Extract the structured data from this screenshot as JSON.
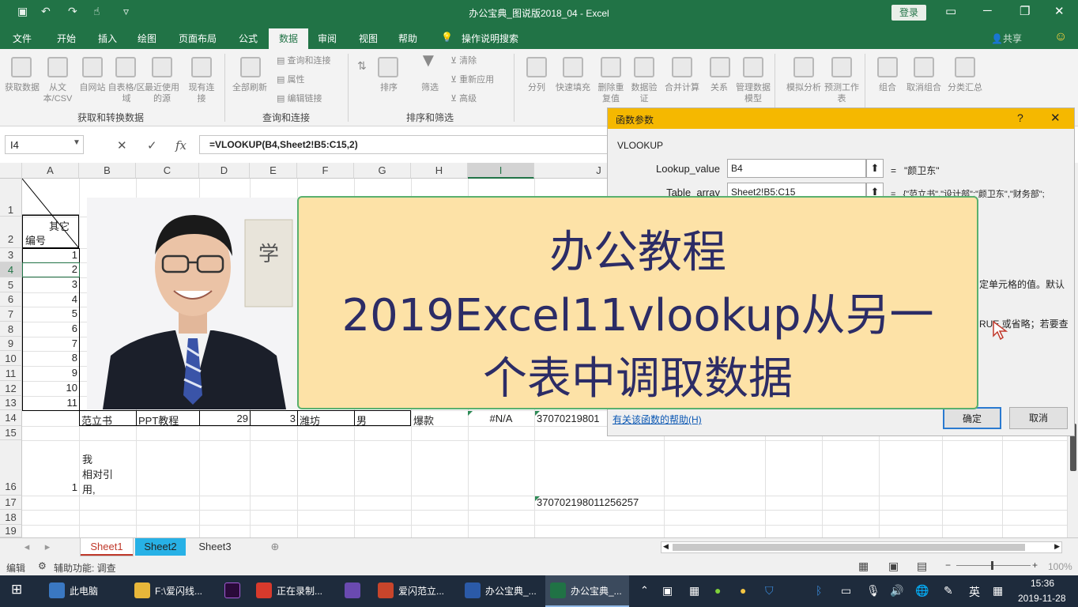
{
  "window": {
    "title": "办公宝典_图说版2018_04 - Excel",
    "login_label": "登录"
  },
  "tabs": [
    "文件",
    "开始",
    "插入",
    "绘图",
    "页面布局",
    "公式",
    "数据",
    "审阅",
    "视图",
    "帮助",
    "操作说明搜索"
  ],
  "active_tab": "数据",
  "share_label": "共享",
  "ribbon": {
    "groups": [
      "获取和转换数据",
      "查询和连接",
      "排序和筛选"
    ],
    "buttons": {
      "get_data": "获取数据",
      "from_csv": "从文本/CSV",
      "from_web": "自网站",
      "from_table": "自表格/区域",
      "recent": "最近使用的源",
      "existing": "现有连接",
      "refresh_all": "全部刷新",
      "queries": "查询和连接",
      "properties": "属性",
      "edit_links": "编辑链接",
      "sort": "排序",
      "filter": "筛选",
      "clear": "清除",
      "reapply": "重新应用",
      "advanced": "高级",
      "split": "分列",
      "flash_fill": "快速填充",
      "remove_dup": "删除重复值",
      "validation": "数据验证",
      "consolidate": "合并计算",
      "relations": "关系",
      "data_model": "管理数据模型",
      "what_if": "模拟分析",
      "forecast": "预测工作表",
      "group": "组合",
      "ungroup": "取消组合",
      "subtotal": "分类汇总"
    }
  },
  "formula_bar": {
    "name_box": "I4",
    "formula": "=VLOOKUP(B4,Sheet2!B5:C15,2)"
  },
  "sheet": {
    "columns": [
      "A",
      "B",
      "C",
      "D",
      "E",
      "F",
      "G",
      "H",
      "I",
      "J"
    ],
    "rows": [
      "1",
      "2",
      "3",
      "4",
      "5",
      "6",
      "7",
      "8",
      "9",
      "10",
      "11",
      "12",
      "13",
      "14",
      "15",
      "16",
      "17",
      "18",
      "19"
    ],
    "header_cell": {
      "top": "其它",
      "bottom": "编号"
    },
    "col_a_numbers": [
      "1",
      "2",
      "3",
      "4",
      "5",
      "6",
      "7",
      "8",
      "9",
      "10",
      "11"
    ],
    "row14": {
      "b": "范立书",
      "c": "PPT教程",
      "d": "29",
      "e": "3",
      "f": "潍坊",
      "g": "男",
      "h": "爆款",
      "i": "#N/A",
      "j": "37070219801"
    },
    "row16": {
      "a": "1",
      "b1": "我",
      "b2": "相对引",
      "b3": "用,"
    },
    "row17": {
      "j": "370702198011256257"
    }
  },
  "sheet_tabs": [
    "Sheet1",
    "Sheet2",
    "Sheet3"
  ],
  "status": {
    "mode": "编辑",
    "accessibility": "辅助功能: 调查",
    "zoom": "100%"
  },
  "dialog": {
    "title": "函数参数",
    "function_name": "VLOOKUP",
    "args": [
      {
        "label": "Lookup_value",
        "value": "B4",
        "result": "\"颜卫东\""
      },
      {
        "label": "Table_array",
        "value": "Sheet2!B5:C15",
        "result": "{\"范立书\",\"设计部\";\"颜卫东\",\"财务部\";"
      }
    ],
    "desc1": "定单元格的值。默认",
    "desc2": "RUE 或省略；若要查",
    "help_link": "有关该函数的帮助(H)",
    "ok": "确定",
    "cancel": "取消"
  },
  "overlay": {
    "line1": "办公教程",
    "line2": "2019Excel11vlookup从另一",
    "line3": "个表中调取数据"
  },
  "taskbar": {
    "items": [
      "此电脑",
      "F:\\爱闪线...",
      "正在录制...",
      "爱闪范立...",
      "办公宝典_...",
      "办公宝典_..."
    ],
    "lang": "英",
    "time": "15:36",
    "date": "2019-11-28"
  }
}
